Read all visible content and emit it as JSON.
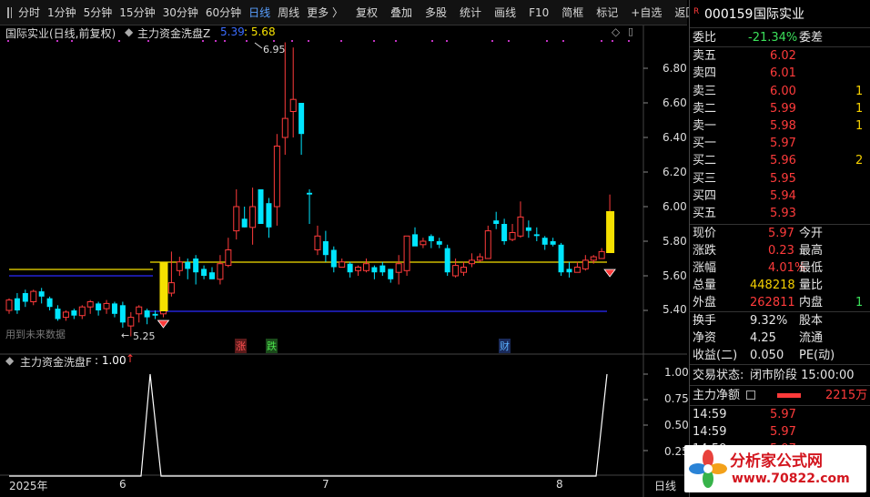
{
  "toolbar": {
    "items": [
      "分时",
      "1分钟",
      "5分钟",
      "15分钟",
      "30分钟",
      "60分钟",
      "日线",
      "周线",
      "更多 〉"
    ],
    "active_index": 6,
    "tools": [
      "复权",
      "叠加",
      "多股",
      "统计",
      "画线",
      "F10",
      "简框",
      "标记",
      "+自选",
      "返回"
    ]
  },
  "chart": {
    "stock_title": "国际实业(日线,前复权)",
    "indicator_title": "主力资金洗盘Z",
    "indicator_values": [
      "5.39",
      ": 5.68"
    ],
    "high_label": "6.95",
    "low_label": "5.25",
    "price_axis": [
      "6.80",
      "6.60",
      "6.40",
      "6.20",
      "6.00",
      "5.80",
      "5.60",
      "5.40"
    ],
    "future_text": "用到未来数据",
    "event_marks": [
      "涨",
      "跌",
      "财"
    ],
    "sub_title": "主力资金洗盘F",
    "sub_value": ": 1.00",
    "sub_axis": [
      "1.00",
      "0.75",
      "0.50",
      "0.25"
    ],
    "date_labels": [
      "2025年",
      "6",
      "7",
      "8"
    ],
    "period_label": "日线"
  },
  "colors": {
    "up": "#ff3b3b",
    "down": "#00e5ff",
    "yellow": "#f5e000",
    "blue": "#2a2aff",
    "white": "#ffffff"
  },
  "candles": [
    [
      5.4,
      5.46,
      5.47,
      5.38
    ],
    [
      5.47,
      5.4,
      5.5,
      5.38
    ],
    [
      5.5,
      5.45,
      5.52,
      5.42
    ],
    [
      5.45,
      5.51,
      5.52,
      5.43
    ],
    [
      5.51,
      5.48,
      5.53,
      5.44
    ],
    [
      5.47,
      5.42,
      5.48,
      5.4
    ],
    [
      5.41,
      5.35,
      5.43,
      5.34
    ],
    [
      5.36,
      5.39,
      5.4,
      5.34
    ],
    [
      5.4,
      5.37,
      5.41,
      5.35
    ],
    [
      5.37,
      5.42,
      5.43,
      5.35
    ],
    [
      5.42,
      5.45,
      5.46,
      5.38
    ],
    [
      5.44,
      5.4,
      5.45,
      5.37
    ],
    [
      5.41,
      5.44,
      5.46,
      5.38
    ],
    [
      5.44,
      5.38,
      5.45,
      5.36
    ],
    [
      5.43,
      5.33,
      5.45,
      5.3
    ],
    [
      5.31,
      5.36,
      5.39,
      5.25
    ],
    [
      5.38,
      5.42,
      5.43,
      5.33
    ],
    [
      5.4,
      5.36,
      5.41,
      5.32
    ],
    [
      5.38,
      5.37,
      5.4,
      5.35
    ],
    [
      5.38,
      5.45,
      5.49,
      5.36
    ],
    [
      5.5,
      5.56,
      5.74,
      5.48
    ],
    [
      5.63,
      5.68,
      5.71,
      5.6
    ],
    [
      5.68,
      5.64,
      5.7,
      5.58
    ],
    [
      5.7,
      5.62,
      5.72,
      5.55
    ],
    [
      5.64,
      5.6,
      5.66,
      5.58
    ],
    [
      5.62,
      5.58,
      5.65,
      5.58
    ],
    [
      5.58,
      5.67,
      5.72,
      5.55
    ],
    [
      5.66,
      5.75,
      5.82,
      5.65
    ],
    [
      5.86,
      6.0,
      6.1,
      5.81
    ],
    [
      5.93,
      5.88,
      6.0,
      5.88
    ],
    [
      5.88,
      6.0,
      6.11,
      5.78
    ],
    [
      6.1,
      5.9,
      6.1,
      5.9
    ],
    [
      6.02,
      5.88,
      6.05,
      5.82
    ],
    [
      6.0,
      6.35,
      6.42,
      5.89
    ],
    [
      6.4,
      6.51,
      6.95,
      6.3
    ],
    [
      6.55,
      6.62,
      6.92,
      6.4
    ],
    [
      6.6,
      6.42,
      6.55,
      6.3
    ],
    [
      6.08,
      6.07,
      6.1,
      5.9
    ],
    [
      5.75,
      5.83,
      5.89,
      5.72
    ],
    [
      5.8,
      5.72,
      5.86,
      5.68
    ],
    [
      5.75,
      5.65,
      5.77,
      5.62
    ],
    [
      5.65,
      5.68,
      5.7,
      5.65
    ],
    [
      5.67,
      5.62,
      5.68,
      5.59
    ],
    [
      5.63,
      5.65,
      5.66,
      5.6
    ],
    [
      5.63,
      5.67,
      5.7,
      5.62
    ],
    [
      5.65,
      5.62,
      5.66,
      5.58
    ],
    [
      5.66,
      5.62,
      5.68,
      5.6
    ],
    [
      5.64,
      5.58,
      5.64,
      5.56
    ],
    [
      5.62,
      5.67,
      5.72,
      5.55
    ],
    [
      5.63,
      5.83,
      5.83,
      5.6
    ],
    [
      5.84,
      5.77,
      5.88,
      5.78
    ],
    [
      5.78,
      5.8,
      5.82,
      5.76
    ],
    [
      5.83,
      5.8,
      5.84,
      5.76
    ],
    [
      5.8,
      5.78,
      5.82,
      5.76
    ],
    [
      5.76,
      5.62,
      5.78,
      5.6
    ],
    [
      5.6,
      5.66,
      5.7,
      5.59
    ],
    [
      5.62,
      5.65,
      5.68,
      5.6
    ],
    [
      5.67,
      5.69,
      5.73,
      5.65
    ],
    [
      5.69,
      5.71,
      5.73,
      5.68
    ],
    [
      5.7,
      5.86,
      5.89,
      5.7
    ],
    [
      5.92,
      5.9,
      5.97,
      5.87
    ],
    [
      5.9,
      5.8,
      5.93,
      5.78
    ],
    [
      5.81,
      5.85,
      5.9,
      5.8
    ],
    [
      5.83,
      5.94,
      6.03,
      5.82
    ],
    [
      5.88,
      5.86,
      5.92,
      5.82
    ],
    [
      5.84,
      5.83,
      5.88,
      5.8
    ],
    [
      5.82,
      5.78,
      5.83,
      5.75
    ],
    [
      5.8,
      5.78,
      5.82,
      5.77
    ],
    [
      5.78,
      5.62,
      5.79,
      5.6
    ],
    [
      5.64,
      5.62,
      5.68,
      5.59
    ],
    [
      5.62,
      5.65,
      5.68,
      5.62
    ],
    [
      5.64,
      5.69,
      5.72,
      5.63
    ],
    [
      5.69,
      5.71,
      5.72,
      5.67
    ],
    [
      5.7,
      5.74,
      5.76,
      5.7
    ],
    [
      5.75,
      5.97,
      6.07,
      5.74
    ]
  ],
  "yellow_bars": [
    19,
    74
  ],
  "signal_points": [
    19,
    74
  ],
  "right_panel": {
    "code": "000159",
    "name": "国际实业",
    "weibi_label": "委比",
    "weibi_value": "-21.34%",
    "weicha_label": "委差",
    "sell": [
      {
        "label": "卖五",
        "price": "6.02",
        "vol": ""
      },
      {
        "label": "卖四",
        "price": "6.01",
        "vol": ""
      },
      {
        "label": "卖三",
        "price": "6.00",
        "vol": "1"
      },
      {
        "label": "卖二",
        "price": "5.99",
        "vol": "1"
      },
      {
        "label": "卖一",
        "price": "5.98",
        "vol": "1"
      }
    ],
    "buy": [
      {
        "label": "买一",
        "price": "5.97",
        "vol": ""
      },
      {
        "label": "买二",
        "price": "5.96",
        "vol": "2"
      },
      {
        "label": "买三",
        "price": "5.95",
        "vol": ""
      },
      {
        "label": "买四",
        "price": "5.94",
        "vol": ""
      },
      {
        "label": "买五",
        "price": "5.93",
        "vol": ""
      }
    ],
    "stats": [
      {
        "l1": "现价",
        "v1": "5.97",
        "l2": "今开",
        "c": "red"
      },
      {
        "l1": "涨跌",
        "v1": "0.23",
        "l2": "最高",
        "c": "red"
      },
      {
        "l1": "涨幅",
        "v1": "4.01%",
        "l2": "最低",
        "c": "red"
      },
      {
        "l1": "总量",
        "v1": "448218",
        "l2": "量比",
        "c": "yellow"
      },
      {
        "l1": "外盘",
        "v1": "262811",
        "l2": "内盘",
        "c": "red",
        "v2": "1"
      }
    ],
    "stats2": [
      {
        "l1": "换手",
        "v1": "9.32%",
        "l2": "股本"
      },
      {
        "l1": "净资",
        "v1": "4.25",
        "l2": "流通"
      },
      {
        "l1": "收益(二)",
        "v1": "0.050",
        "l2": "PE(动)"
      }
    ],
    "trade_state_label": "交易状态:",
    "trade_state": "闭市阶段 15:00:00",
    "netflow_label": "主力净额",
    "netflow_value": "2215万",
    "ticks": [
      {
        "time": "14:59",
        "price": "5.97"
      },
      {
        "time": "14:59",
        "price": "5.97"
      },
      {
        "time": "14:59",
        "price": "5.97"
      }
    ]
  },
  "watermark": {
    "text": "分析家公式网",
    "url": "www.70822.com"
  }
}
